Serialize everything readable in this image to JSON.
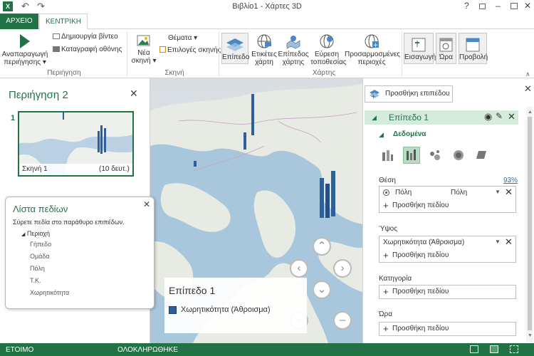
{
  "window": {
    "title": "Βιβλίο1 - Χάρτες 3D",
    "help": "?",
    "min": "–",
    "close": "✕"
  },
  "tabs": {
    "file": "ΑΡΧΕΙΟ",
    "home": "ΚΕΝΤΡΙΚΗ"
  },
  "ribbon": {
    "tour": {
      "play_label1": "Αναπαραγωγή",
      "play_label2": "περιήγησης ▾",
      "create_video": "Δημιουργία βίντεο",
      "capture_screen": "Καταγραφή οθόνης",
      "group": "Περιήγηση"
    },
    "scene": {
      "new_scene1": "Νέα",
      "new_scene2": "σκηνή ▾",
      "themes": "Θέματα ▾",
      "scene_options": "Επιλογές σκηνής",
      "group": "Σκηνή"
    },
    "layer": {
      "label": "Επίπεδο"
    },
    "map": {
      "labels1": "Ετικέτες",
      "labels2": "χάρτη",
      "flat1": "Επίπεδος",
      "flat2": "χάρτης",
      "find1": "Εύρεση",
      "find2": "τοποθεσίας",
      "custom1": "Προσαρμοσμένες",
      "custom2": "περιοχές",
      "group": "Χάρτης"
    },
    "insert": {
      "label": "Εισαγωγή"
    },
    "time": {
      "label": "Ώρα"
    },
    "view": {
      "label": "Προβολή"
    }
  },
  "tour_panel": {
    "title": "Περιήγηση 2",
    "scene_number": "1",
    "scene_name": "Σκηνή 1",
    "scene_duration": "(10 δευτ.)"
  },
  "field_list": {
    "title": "Λίστα πεδίων",
    "hint": "Σύρετε πεδία στο παράθυρο επιπέδων.",
    "table": "Περιοχή",
    "fields": [
      "Γήπεδο",
      "Ομάδα",
      "Πόλη",
      "Τ.Κ.",
      "Χωρητικότητα"
    ]
  },
  "legend": {
    "title": "Επίπεδο 1",
    "series": "Χωρητικότητα (Άθροισμα)",
    "color": "#2e5f9a"
  },
  "layer_pane": {
    "add_layer": "Προσθήκη επιπέδου",
    "layer_name": "Επίπεδο 1",
    "data_header": "Δεδομένα",
    "location_label": "Θέση",
    "location_pct": "93%",
    "location_field": "Πόλη",
    "location_type": "Πόλη",
    "add_field": "Προσθήκη πεδίου",
    "height_label": "Ύψος",
    "height_field": "Χωρητικότητα (Άθροισμα)",
    "category_label": "Κατηγορία",
    "time_label": "Ώρα"
  },
  "status": {
    "ready": "ΕΤΟΙΜΟ",
    "completed": "ΟΛΟΚΛΗΡΩΘΗΚΕ"
  },
  "colors": {
    "accent": "#217346",
    "layer_header": "#d5ecdd",
    "bar": "#2e5f9a"
  }
}
